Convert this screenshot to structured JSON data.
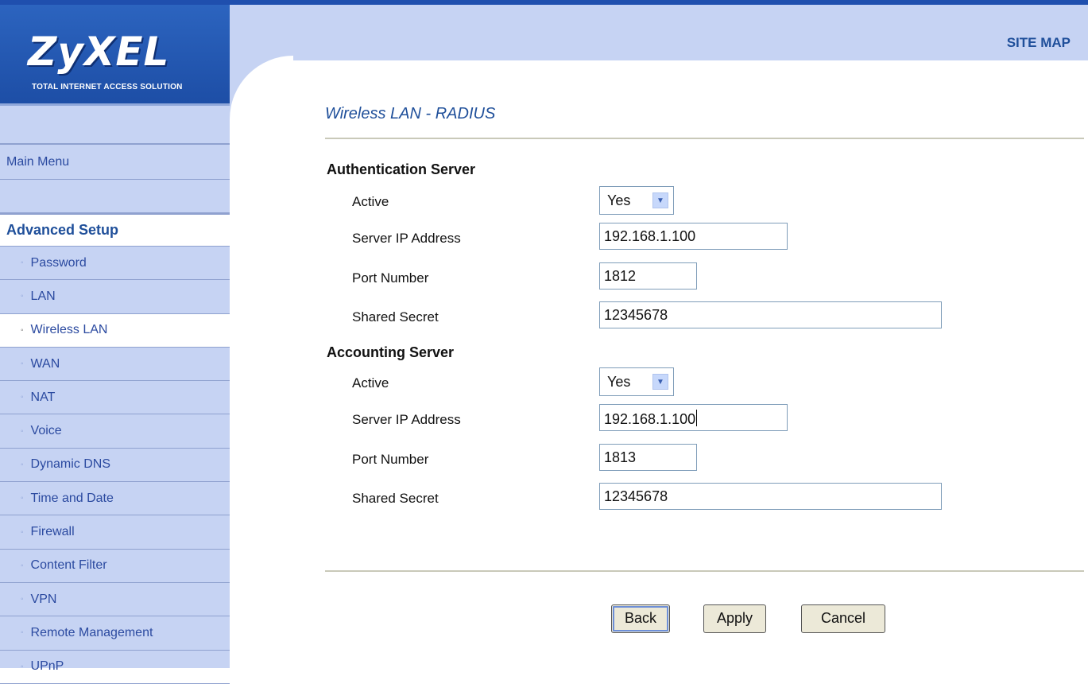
{
  "brand": {
    "logo": "ZyXEL",
    "tagline": "TOTAL INTERNET ACCESS SOLUTION"
  },
  "header": {
    "site_map": "SITE MAP"
  },
  "sidebar": {
    "main_menu": "Main Menu",
    "section": "Advanced Setup",
    "items": [
      {
        "label": "Password",
        "active": false
      },
      {
        "label": "LAN",
        "active": false
      },
      {
        "label": "Wireless LAN",
        "active": true
      },
      {
        "label": "WAN",
        "active": false
      },
      {
        "label": "NAT",
        "active": false
      },
      {
        "label": "Voice",
        "active": false
      },
      {
        "label": "Dynamic DNS",
        "active": false
      },
      {
        "label": "Time and Date",
        "active": false
      },
      {
        "label": "Firewall",
        "active": false
      },
      {
        "label": "Content Filter",
        "active": false
      },
      {
        "label": "VPN",
        "active": false
      },
      {
        "label": "Remote Management",
        "active": false
      },
      {
        "label": "UPnP",
        "active": false
      }
    ]
  },
  "page": {
    "title": "Wireless LAN - RADIUS"
  },
  "auth": {
    "title": "Authentication Server",
    "active_label": "Active",
    "active_value": "Yes",
    "ip_label": "Server IP Address",
    "ip_value": "192.168.1.100",
    "port_label": "Port Number",
    "port_value": "1812",
    "secret_label": "Shared Secret",
    "secret_value": "12345678"
  },
  "acct": {
    "title": "Accounting Server",
    "active_label": "Active",
    "active_value": "Yes",
    "ip_label": "Server IP Address",
    "ip_value": "192.168.1.100",
    "port_label": "Port Number",
    "port_value": "1813",
    "secret_label": "Shared Secret",
    "secret_value": "12345678"
  },
  "buttons": {
    "back": "Back",
    "apply": "Apply",
    "cancel": "Cancel"
  },
  "colors": {
    "brand_blue": "#1f4fae",
    "sidebar_bg": "#c6d3f3",
    "title_blue": "#1f4f9a"
  }
}
